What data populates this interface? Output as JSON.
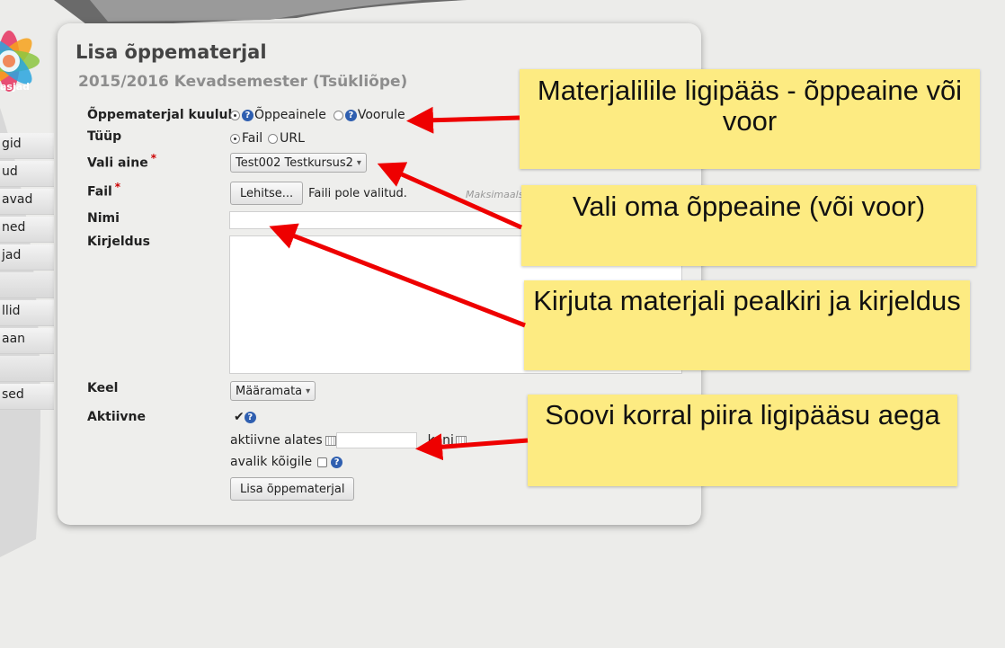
{
  "sidebar": {
    "logo_text": "asjad",
    "items": [
      "gid",
      "ud",
      "avad",
      "ned",
      "jad",
      "",
      "llid",
      "aan",
      "",
      "sed"
    ]
  },
  "panel": {
    "title": "Lisa õppematerjal",
    "subtitle": "2015/2016 Kevadsemester (Tsükliõpe)"
  },
  "form": {
    "belongs_label": "Õppematerjal kuulub",
    "belongs_options": [
      "Õppeainele",
      "Voorule"
    ],
    "type_label": "Tüüp",
    "type_options": [
      "Fail",
      "URL"
    ],
    "course_label": "Vali aine",
    "course_value": "Test002 Testkursus2",
    "file_label": "Fail",
    "browse_button": "Lehitse...",
    "no_file_text": "Faili pole valitud.",
    "max_text": "Maksimaals",
    "name_label": "Nimi",
    "name_value": "",
    "description_label": "Kirjeldus",
    "description_value": "",
    "language_label": "Keel",
    "language_value": "Määramata",
    "active_label": "Aktiivne",
    "active_from_label": "aktiivne alates",
    "active_to_label": "kuni",
    "public_label": "avalik kõigile",
    "submit_button": "Lisa õppematerjal",
    "required_mark": "*",
    "help_glyph": "?",
    "check_glyph": "✔"
  },
  "annotations": [
    "Materjalilile ligipääs - õppeaine või voor",
    "Vali oma õppeaine (või voor)",
    "Kirjuta materjali pealkiri ja kirjeldus",
    "Soovi korral piira ligipääsu aega"
  ],
  "colors": {
    "note_bg": "#fdeb82",
    "arrow": "#ee0000",
    "help_icon": "#2f5fb0"
  }
}
